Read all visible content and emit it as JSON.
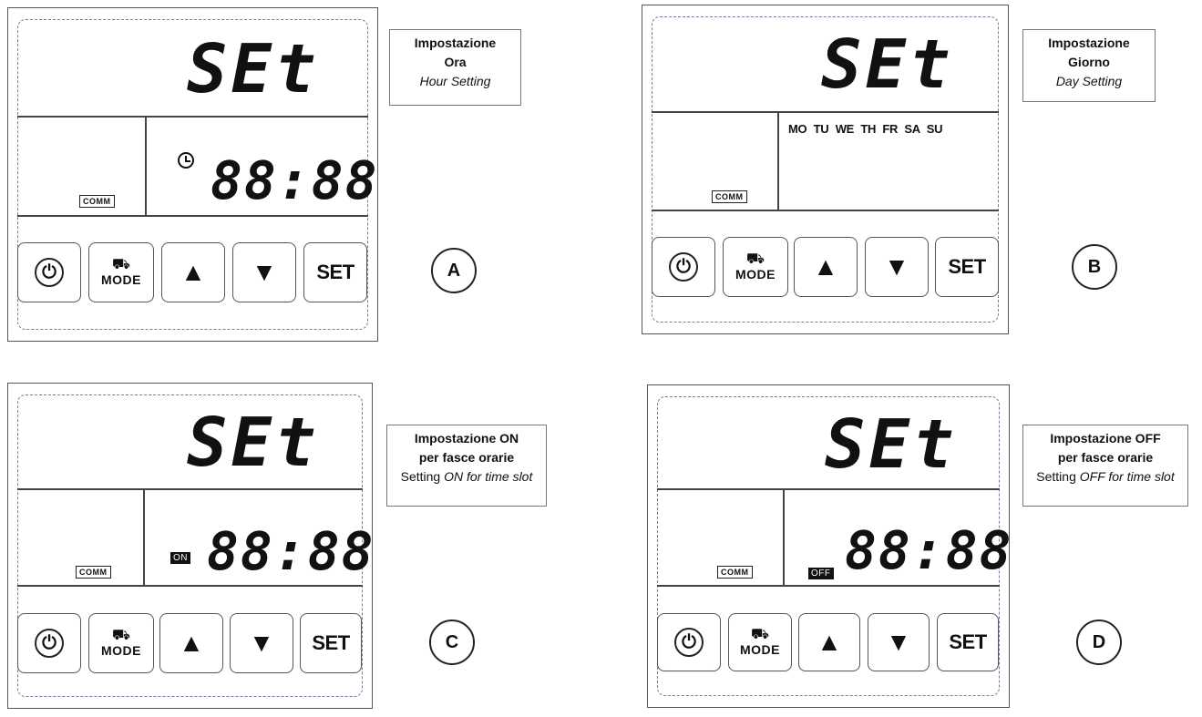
{
  "display": {
    "set_text": "SEt",
    "time_text": "88:88",
    "comm_label": "COMM",
    "days": "MO TU WE TH FR SA SU",
    "on_tag": "ON",
    "off_tag": "OFF"
  },
  "buttons": {
    "power_glyph": "⏻",
    "mode_glyph": "⛟",
    "mode_label": "MODE",
    "up_arrow": "▲",
    "down_arrow": "▼",
    "set_label": "SET"
  },
  "panels": {
    "A": {
      "letter": "A",
      "callout": {
        "line1": "Impostazione",
        "line2": "Ora",
        "line3": "Hour Setting"
      }
    },
    "B": {
      "letter": "B",
      "callout": {
        "line1": "Impostazione",
        "line2": "Giorno",
        "line3": "Day Setting"
      }
    },
    "C": {
      "letter": "C",
      "callout": {
        "line1": "Impostazione ON",
        "line2": "per fasce orarie",
        "line3_plain": "Setting ",
        "line3_italic": "ON for time slot"
      }
    },
    "D": {
      "letter": "D",
      "callout": {
        "line1": "Impostazione OFF",
        "line2": "per fasce orarie",
        "line3_plain": "Setting ",
        "line3_italic": "OFF for time slot"
      }
    }
  }
}
